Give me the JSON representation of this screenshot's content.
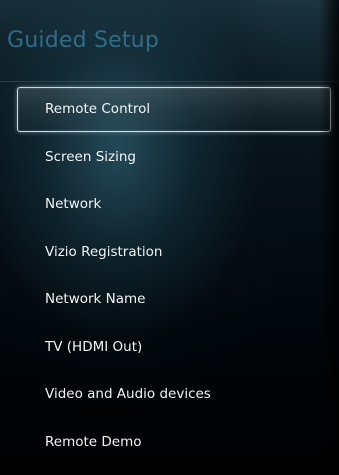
{
  "screen": {
    "title": "Guided Setup"
  },
  "menu": {
    "selected_index": 0,
    "items": [
      {
        "label": "Remote Control"
      },
      {
        "label": "Screen Sizing"
      },
      {
        "label": "Network"
      },
      {
        "label": "Vizio Registration"
      },
      {
        "label": "Network Name"
      },
      {
        "label": "TV (HDMI Out)"
      },
      {
        "label": "Video and Audio devices"
      },
      {
        "label": "Remote Demo"
      }
    ]
  },
  "colors": {
    "title": "#2f6c88",
    "item_text": "#f2f4f5",
    "selection_border": "#e1ebf0",
    "background_top": "#1b3440",
    "background_bottom": "#000000"
  }
}
